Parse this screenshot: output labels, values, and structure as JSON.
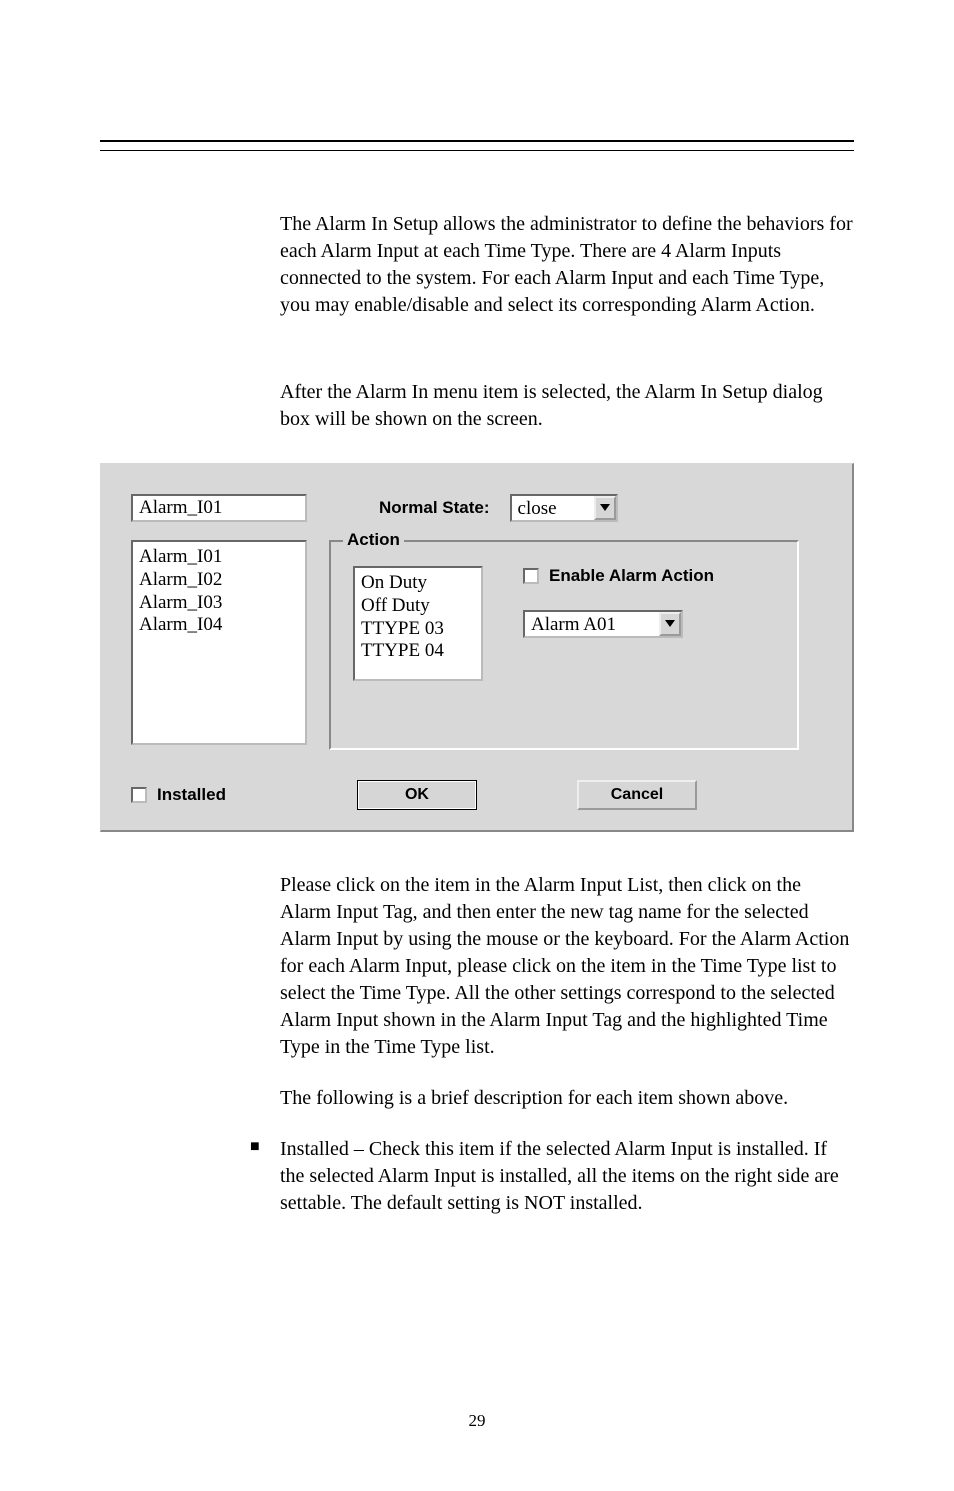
{
  "paragraphs": {
    "intro": "The Alarm In Setup allows the administrator to define the behaviors for each Alarm Input at each Time Type.    There are 4 Alarm Inputs connected to the system.    For each Alarm Input and each Time Type, you may enable/disable and select its corresponding Alarm Action.",
    "after_select": "After the Alarm In menu item is selected, the Alarm In Setup dialog box will be shown on the screen.",
    "please_click": "Please click on the item in the Alarm Input List, then click on the Alarm Input Tag, and then enter the new tag name for the selected Alarm Input by using the mouse or the keyboard.    For the Alarm Action for each Alarm Input, please click on the item in the Time Type list to select the Time Type.    All the other settings correspond to the selected Alarm Input shown in the Alarm Input Tag and the highlighted Time Type in the Time Type list.",
    "following": "The following is a brief description for each item shown above."
  },
  "bullet": {
    "installed": "Installed – Check this item if the selected Alarm Input is installed.  If the selected Alarm Input is installed, all the items on the right side are settable.    The default setting is NOT installed."
  },
  "dialog": {
    "alarm_input_tag": "Alarm_I01",
    "normal_state_label": "Normal State:",
    "normal_state_value": "close",
    "alarm_list": [
      "Alarm_I01",
      "Alarm_I02",
      "Alarm_I03",
      "Alarm_I04"
    ],
    "action_legend": "Action",
    "ttype_list": [
      "On Duty",
      "Off Duty",
      "TTYPE 03",
      "TTYPE 04"
    ],
    "enable_alarm_action_label": "Enable Alarm Action",
    "alarm_action_value": "Alarm A01",
    "installed_label": "Installed",
    "ok_label": "OK",
    "cancel_label": "Cancel"
  },
  "page_number": "29"
}
